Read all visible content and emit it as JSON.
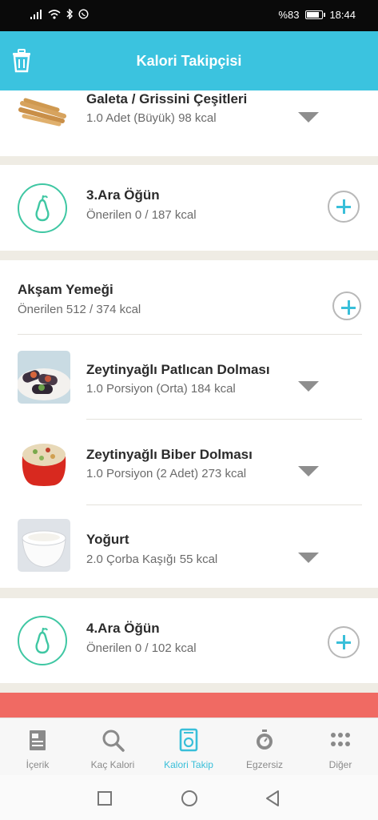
{
  "status": {
    "battery_text": "%83",
    "time": "18:44",
    "battery_level": 0.83
  },
  "header": {
    "title": "Kalori Takipçisi"
  },
  "meals": {
    "galeta": {
      "name": "Galeta / Grissini Çeşitleri",
      "detail": "1.0 Adet (Büyük) 98 kcal"
    },
    "snack3": {
      "title": "3.Ara Öğün",
      "detail": "Önerilen 0 / 187 kcal"
    },
    "dinner": {
      "title": "Akşam Yemeği",
      "detail": "Önerilen 512 / 374 kcal",
      "items": [
        {
          "name": "Zeytinyağlı Patlıcan Dolması",
          "detail": "1.0 Porsiyon (Orta) 184 kcal"
        },
        {
          "name": "Zeytinyağlı Biber Dolması",
          "detail": "1.0 Porsiyon (2 Adet) 273 kcal"
        },
        {
          "name": "Yoğurt",
          "detail": "2.0 Çorba Kaşığı 55 kcal"
        }
      ]
    },
    "snack4": {
      "title": "4.Ara Öğün",
      "detail": "Önerilen 0 / 102 kcal"
    }
  },
  "tabs": [
    {
      "label": "İçerik",
      "icon": "document-icon"
    },
    {
      "label": "Kaç Kalori",
      "icon": "search-icon"
    },
    {
      "label": "Kalori Takip",
      "icon": "scale-icon",
      "active": true
    },
    {
      "label": "Egzersiz",
      "icon": "stopwatch-icon"
    },
    {
      "label": "Diğer",
      "icon": "more-icon"
    }
  ],
  "colors": {
    "accent": "#3bc3df",
    "pear": "#3fc7a3",
    "alert": "#f06a63"
  }
}
